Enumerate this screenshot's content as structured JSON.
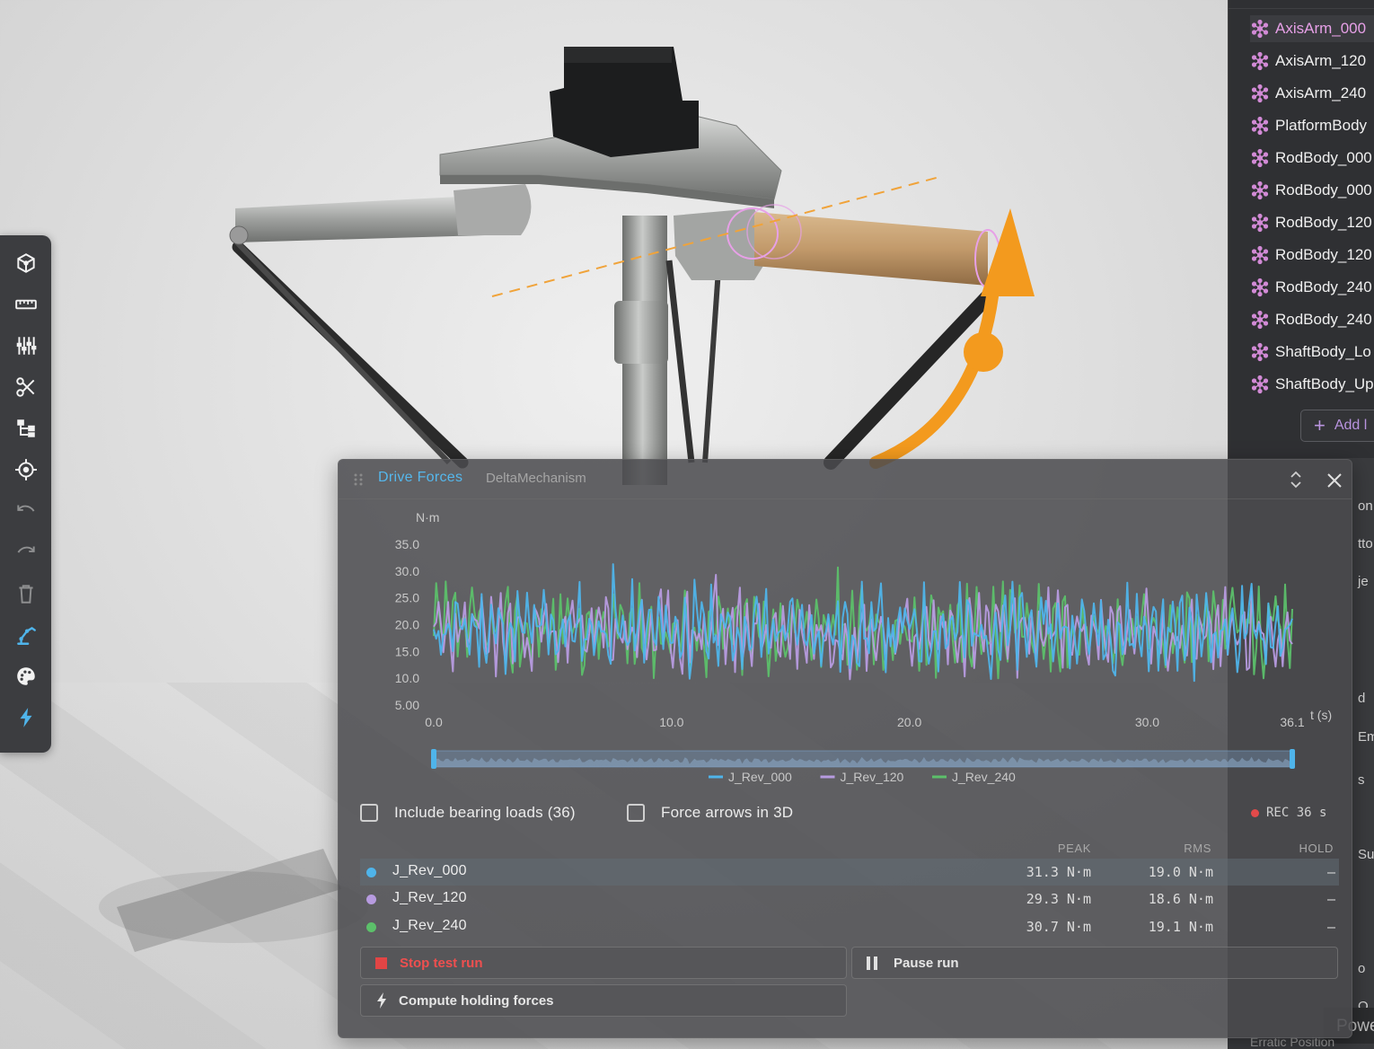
{
  "toolbar": {
    "tools": [
      {
        "icon": "view-cube-icon",
        "label": ""
      },
      {
        "icon": "ruler-icon",
        "label": ""
      },
      {
        "icon": "sliders-icon",
        "label": ""
      },
      {
        "icon": "scissors-icon",
        "label": ""
      },
      {
        "icon": "hierarchy-icon",
        "label": ""
      },
      {
        "icon": "target-icon",
        "label": ""
      },
      {
        "icon": "undo-icon",
        "label": ""
      },
      {
        "icon": "redo-icon",
        "label": ""
      },
      {
        "icon": "trash-icon",
        "label": ""
      },
      {
        "icon": "robot-arm-icon",
        "label": ""
      },
      {
        "icon": "palette-icon",
        "label": ""
      },
      {
        "icon": "bolt-icon",
        "label": ""
      }
    ],
    "accent": "#4fb4ea"
  },
  "outliner": {
    "items": [
      {
        "label": "AxisArm_000",
        "selected": true
      },
      {
        "label": "AxisArm_120",
        "selected": false
      },
      {
        "label": "AxisArm_240",
        "selected": false
      },
      {
        "label": "PlatformBody",
        "selected": false
      },
      {
        "label": "RodBody_000",
        "selected": false
      },
      {
        "label": "RodBody_000",
        "selected": false
      },
      {
        "label": "RodBody_120",
        "selected": false
      },
      {
        "label": "RodBody_120",
        "selected": false
      },
      {
        "label": "RodBody_240",
        "selected": false
      },
      {
        "label": "RodBody_240",
        "selected": false
      },
      {
        "label": "ShaftBody_Lo",
        "selected": false
      },
      {
        "label": "ShaftBody_Up",
        "selected": false
      }
    ],
    "add_button_label": "Add l",
    "body_icon_color": "#d28ad6"
  },
  "right_fragments": [
    "on",
    "tto",
    "je",
    "d",
    "Em",
    "s",
    "Sur",
    "o",
    "O"
  ],
  "power_badge": "Powe",
  "erratic_label": "Erratic Position",
  "panel": {
    "title": "Drive Forces",
    "subtitle": "DeltaMechanism",
    "rec_label": "REC 36 s",
    "options": [
      {
        "label": "Include bearing loads (36)",
        "checked": false
      },
      {
        "label": "Force arrows in 3D",
        "checked": false
      }
    ],
    "table": {
      "headers": {
        "peak": "PEAK",
        "rms": "RMS",
        "hold": "HOLD"
      },
      "rows": [
        {
          "name": "J_Rev_000",
          "color": "#4fb4ea",
          "peak": "31.3 N·m",
          "rms": "19.0 N·m",
          "hold": "—",
          "active": true
        },
        {
          "name": "J_Rev_120",
          "color": "#b79be0",
          "peak": "29.3 N·m",
          "rms": "18.6 N·m",
          "hold": "—",
          "active": false
        },
        {
          "name": "J_Rev_240",
          "color": "#5cc06a",
          "peak": "30.7 N·m",
          "rms": "19.1 N·m",
          "hold": "—",
          "active": false
        }
      ]
    },
    "buttons": {
      "stop": "Stop test run",
      "pause": "Pause run",
      "compute": "Compute holding forces"
    }
  },
  "chart_data": {
    "type": "line",
    "ylabel": "N·m",
    "xlabel": "t (s)",
    "ylim": [
      5.0,
      35.0
    ],
    "xlim": [
      0.0,
      36.1
    ],
    "y_ticks": [
      "35.0",
      "30.0",
      "25.0",
      "20.0",
      "15.0",
      "10.0",
      "5.00"
    ],
    "x_ticks": [
      "0.0",
      "10.0",
      "20.0",
      "30.0",
      "36.1"
    ],
    "grid": false,
    "legend": "bottom",
    "series": [
      {
        "name": "J_Rev_000",
        "color": "#4fb4ea",
        "mean": 19.0,
        "amplitude": 7.8,
        "peak": 31.3,
        "seed": 11
      },
      {
        "name": "J_Rev_120",
        "color": "#b79be0",
        "mean": 18.6,
        "amplitude": 7.2,
        "peak": 29.3,
        "seed": 23
      },
      {
        "name": "J_Rev_240",
        "color": "#5cc06a",
        "mean": 19.1,
        "amplitude": 7.6,
        "peak": 30.7,
        "seed": 37
      }
    ],
    "samples": 360,
    "range_selector": {
      "from": 0.0,
      "to": 36.1
    }
  }
}
